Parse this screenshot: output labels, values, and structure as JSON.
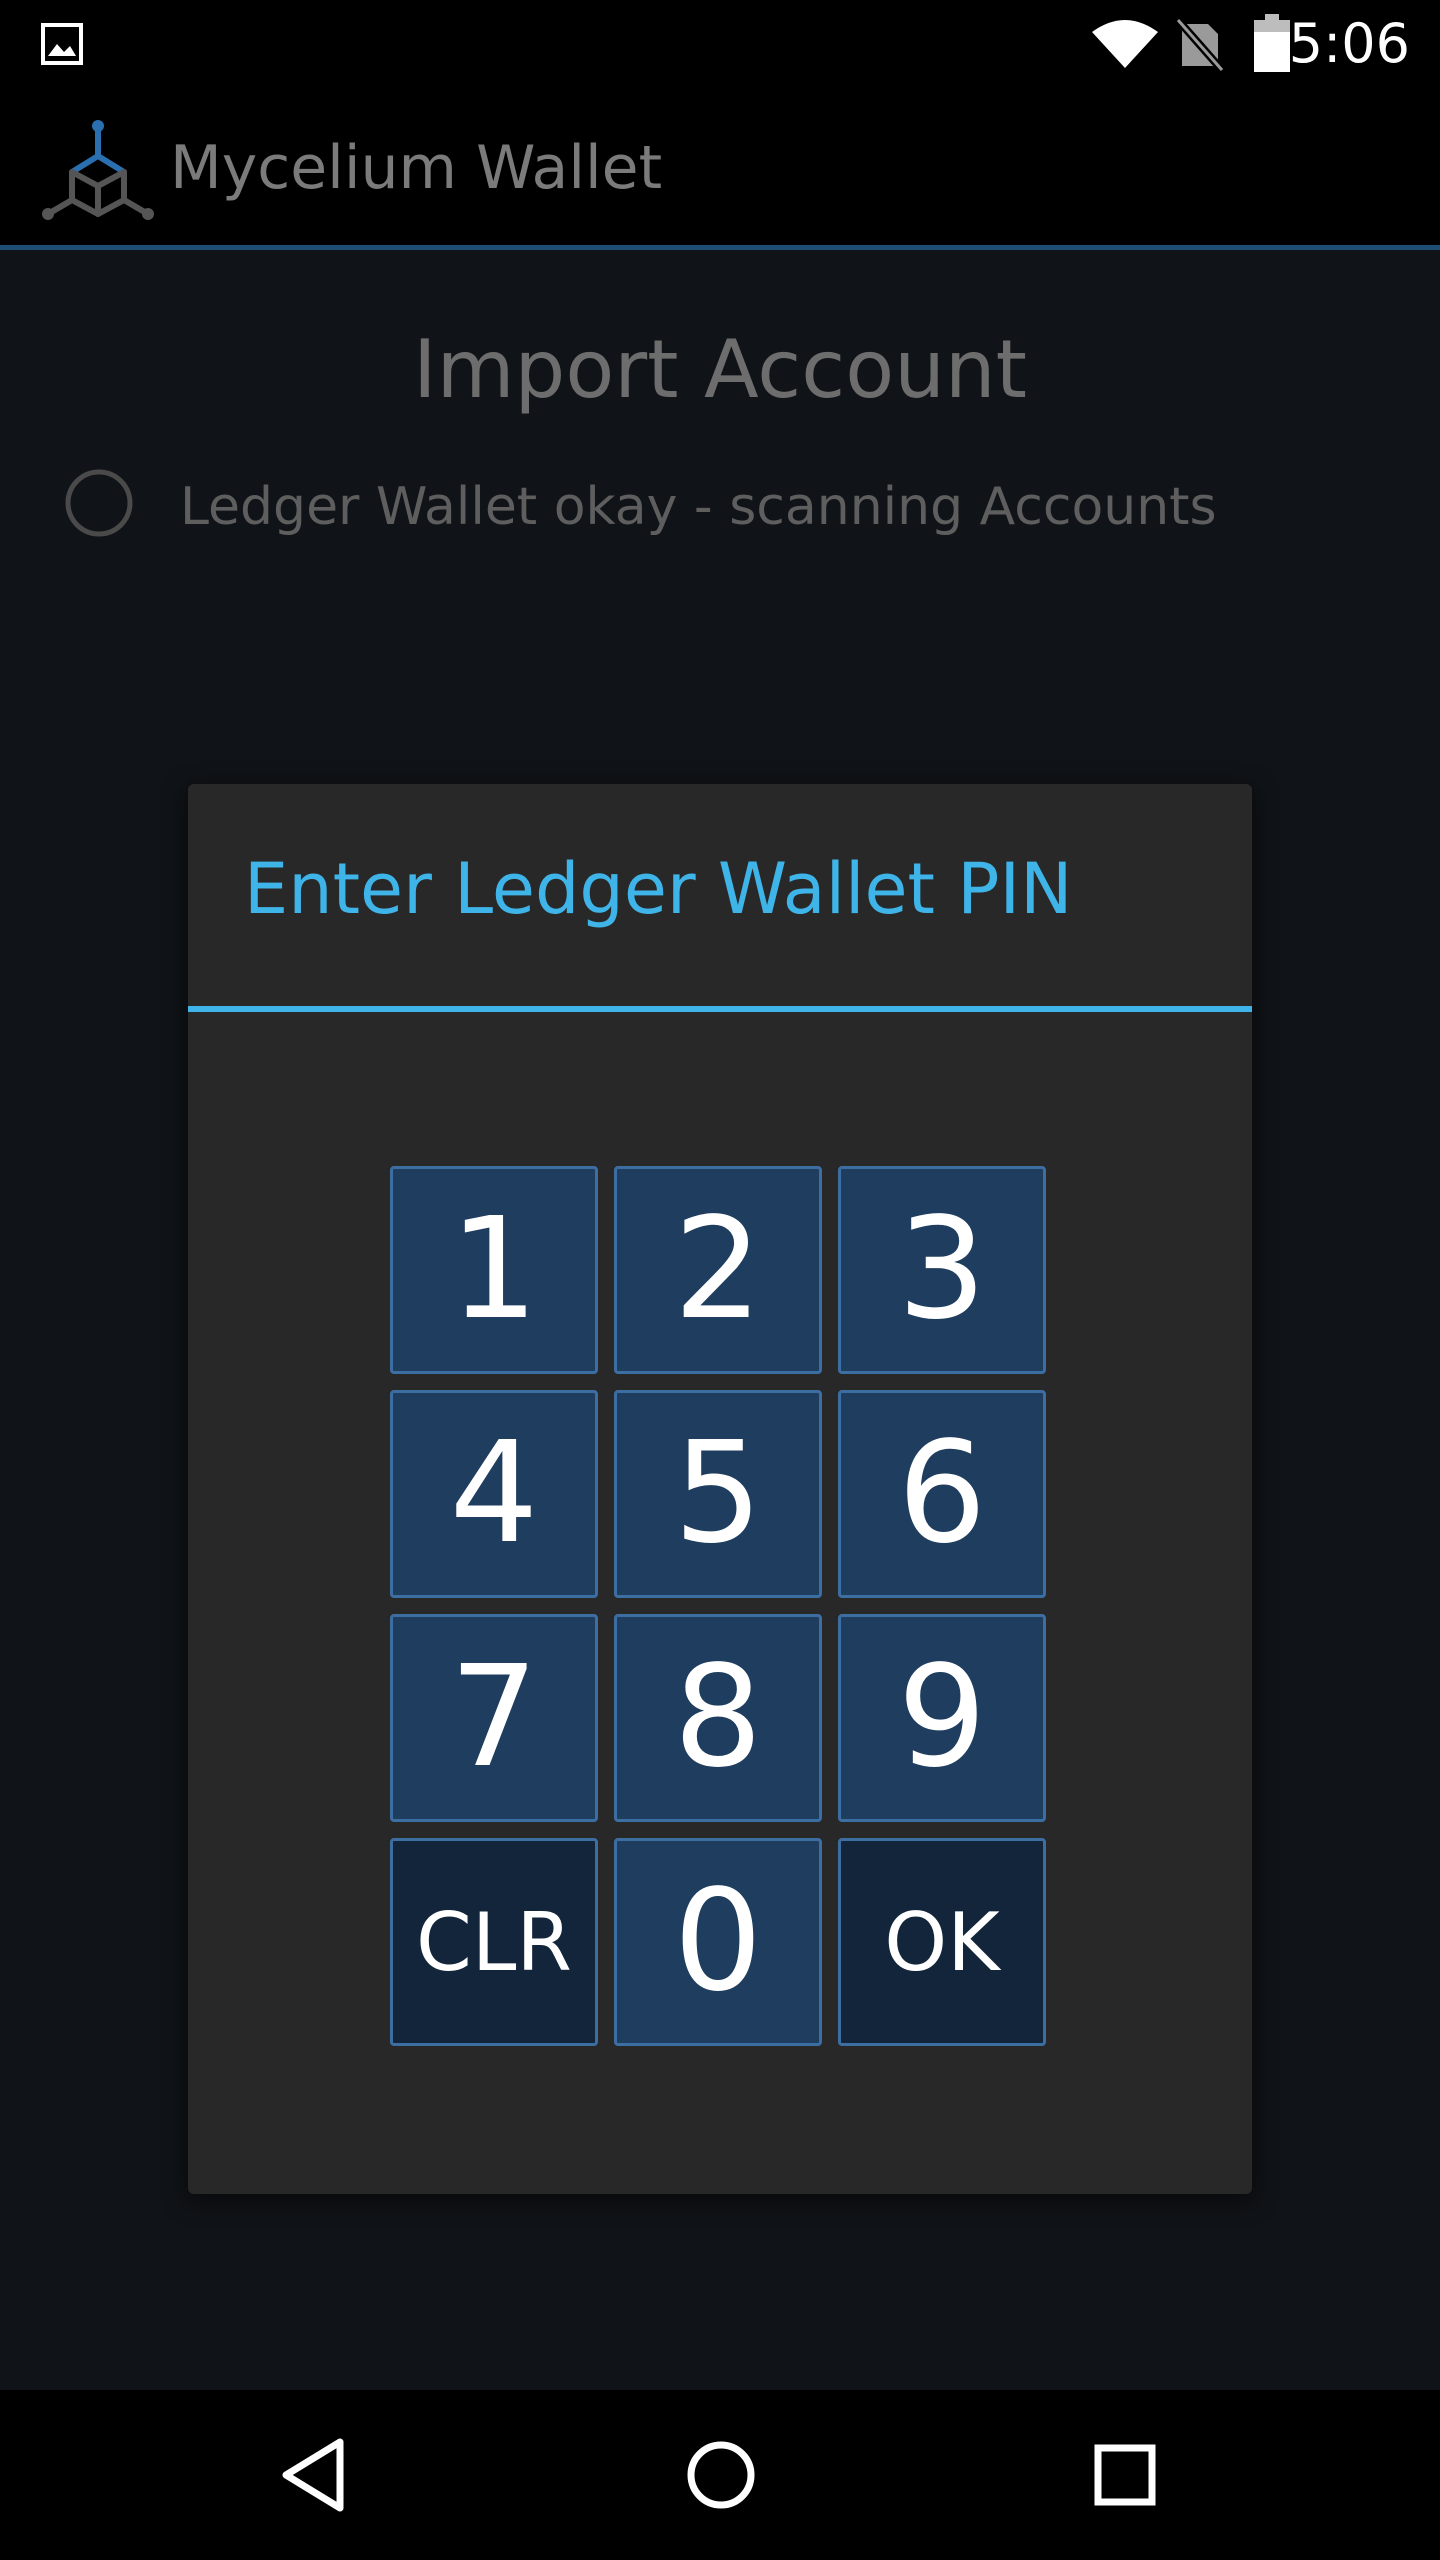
{
  "status_bar": {
    "time": "5:06",
    "icons": [
      "gallery-icon",
      "wifi-icon",
      "no-sim-icon",
      "battery-icon"
    ]
  },
  "app_bar": {
    "title": "Mycelium Wallet",
    "logo": "mycelium-logo-icon"
  },
  "page": {
    "title": "Import Account",
    "status_text": "Ledger Wallet okay - scanning Accounts"
  },
  "dialog": {
    "title": "Enter Ledger Wallet PIN",
    "keys": [
      {
        "label": "1",
        "kind": "digit"
      },
      {
        "label": "2",
        "kind": "digit"
      },
      {
        "label": "3",
        "kind": "digit"
      },
      {
        "label": "4",
        "kind": "digit"
      },
      {
        "label": "5",
        "kind": "digit"
      },
      {
        "label": "6",
        "kind": "digit"
      },
      {
        "label": "7",
        "kind": "digit"
      },
      {
        "label": "8",
        "kind": "digit"
      },
      {
        "label": "9",
        "kind": "digit"
      },
      {
        "label": "CLR",
        "kind": "cmd"
      },
      {
        "label": "0",
        "kind": "digit"
      },
      {
        "label": "OK",
        "kind": "cmd"
      }
    ]
  },
  "nav_bar": {
    "buttons": [
      "back-icon",
      "home-icon",
      "recents-icon"
    ]
  },
  "colors": {
    "accent": "#3fb4e8",
    "key_bg": "#1f3d5e",
    "key_border": "#3c6ea2",
    "cmd_key_bg": "#13253a",
    "dialog_bg": "#282828"
  }
}
